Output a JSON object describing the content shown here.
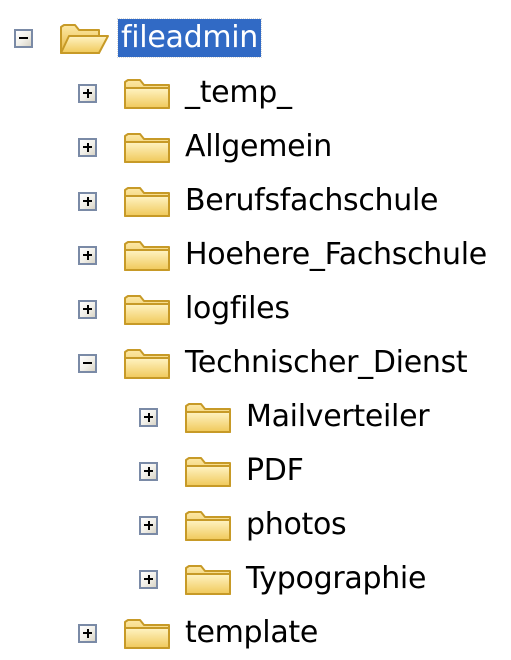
{
  "tree": {
    "root": {
      "label": "fileadmin",
      "expanded": true,
      "selected": true,
      "icon": "folder-open-icon"
    },
    "children": [
      {
        "label": "_temp_",
        "expanded": false,
        "icon": "folder-icon"
      },
      {
        "label": "Allgemein",
        "expanded": false,
        "icon": "folder-icon"
      },
      {
        "label": "Berufsfachschule",
        "expanded": false,
        "icon": "folder-icon"
      },
      {
        "label": "Hoehere_Fachschule",
        "expanded": false,
        "icon": "folder-icon"
      },
      {
        "label": "logfiles",
        "expanded": false,
        "icon": "folder-icon"
      },
      {
        "label": "Technischer_Dienst",
        "expanded": true,
        "icon": "folder-icon",
        "children": [
          {
            "label": "Mailverteiler",
            "expanded": false,
            "icon": "folder-icon"
          },
          {
            "label": "PDF",
            "expanded": false,
            "icon": "folder-icon"
          },
          {
            "label": "photos",
            "expanded": false,
            "icon": "folder-icon"
          },
          {
            "label": "Typographie",
            "expanded": false,
            "icon": "folder-icon"
          }
        ]
      },
      {
        "label": "template",
        "expanded": false,
        "icon": "folder-icon"
      }
    ]
  },
  "colors": {
    "selection": "#316ac5",
    "folder": "#f6d87a",
    "folder_outline": "#c79a27",
    "toggle_border": "#7a8aa6"
  }
}
